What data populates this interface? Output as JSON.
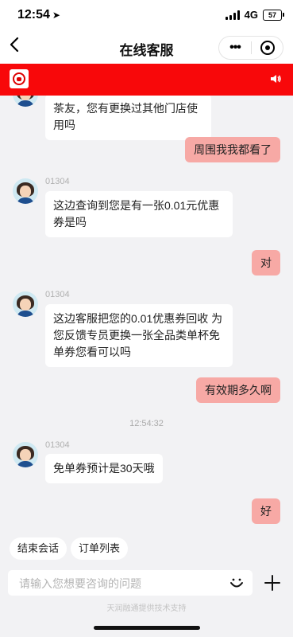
{
  "status_bar": {
    "time": "12:54",
    "network": "4G",
    "battery": "57"
  },
  "nav": {
    "title": "在线客服",
    "more_label": "•••"
  },
  "messages": [
    {
      "side": "agent",
      "text": "茶友，您有更换过其他门店使用吗"
    },
    {
      "side": "user",
      "text": "周围我我都看了"
    },
    {
      "side": "agent",
      "name": "01304",
      "text": "这边查询到您是有一张0.01元优惠券是吗"
    },
    {
      "side": "user",
      "text": "对"
    },
    {
      "side": "agent",
      "name": "01304",
      "text": "这边客服把您的0.01优惠券回收 为您反馈专员更换一张全品类单杯免单券您看可以吗"
    },
    {
      "side": "user",
      "text": "有效期多久啊"
    },
    {
      "side": "agent",
      "name": "01304",
      "text": "免单券预计是30天哦"
    },
    {
      "side": "user",
      "text": "好"
    }
  ],
  "timestamp": "12:54:32",
  "quick_actions": [
    "结束会话",
    "订单列表"
  ],
  "input": {
    "placeholder": "请输入您想要咨询的问题"
  },
  "footer": "天润融通提供技术支持",
  "colors": {
    "banner": "#f8080a",
    "user_bubble": "#f7a9a5",
    "background": "#f2f2f4"
  }
}
